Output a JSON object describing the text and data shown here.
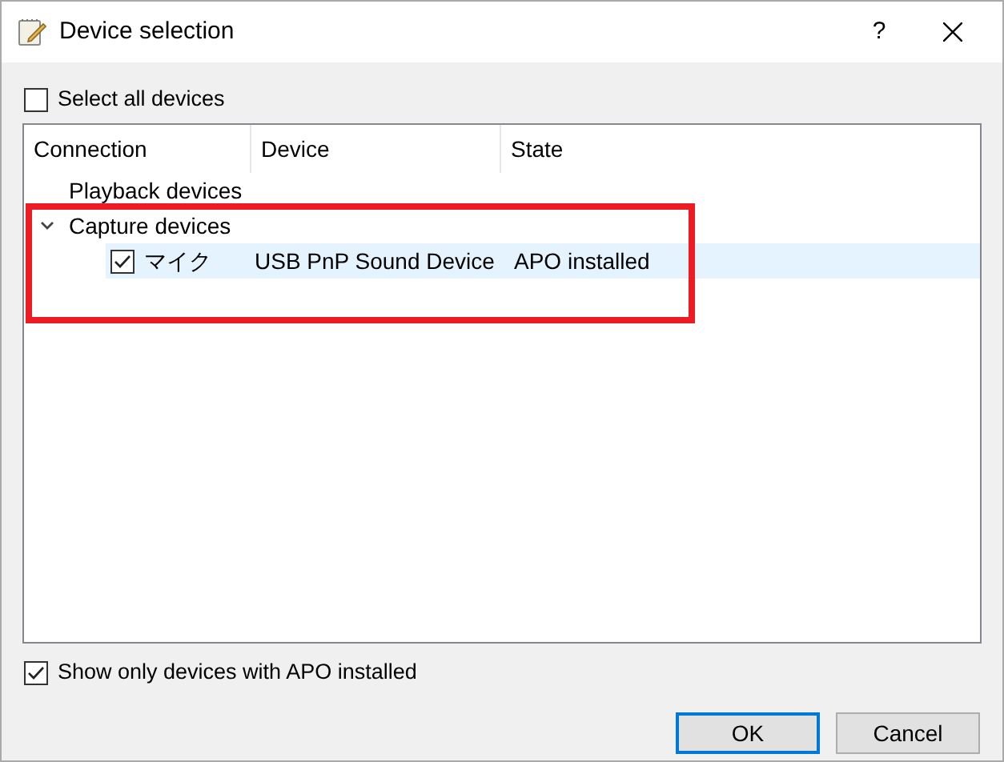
{
  "window": {
    "title": "Device selection",
    "help": "?"
  },
  "select_all": {
    "label": "Select all devices",
    "checked": false
  },
  "tree": {
    "columns": [
      "Connection",
      "Device",
      "State"
    ],
    "groups": [
      {
        "label": "Playback devices",
        "expanded": false
      },
      {
        "label": "Capture devices",
        "expanded": true,
        "children": [
          {
            "connection": "マイク",
            "device": "USB PnP Sound Device",
            "state": "APO installed",
            "checked": true,
            "selected": true
          }
        ]
      }
    ]
  },
  "show_only_apo": {
    "label": "Show only devices with APO installed",
    "checked": true
  },
  "buttons": [
    {
      "label": "OK",
      "default": true
    },
    {
      "label": "Cancel",
      "default": false
    }
  ]
}
